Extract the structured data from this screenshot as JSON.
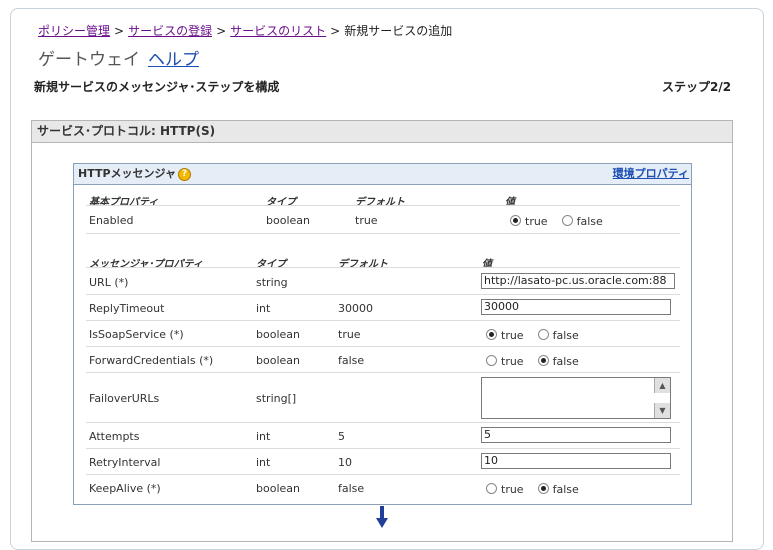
{
  "breadcrumb": {
    "items": [
      "ポリシー管理",
      "サービスの登録",
      "サービスのリスト"
    ],
    "current": "新規サービスの追加",
    "separator": ">"
  },
  "header": {
    "gateway": "ゲートウェイ",
    "help": "ヘルプ"
  },
  "page": {
    "title": "新規サービスのメッセンジャ･ステップを構成",
    "step": "ステップ2/2"
  },
  "section": {
    "title": "サービス･プロトコル: HTTP(S)"
  },
  "panel": {
    "title": "HTTPメッセンジャ",
    "help_icon": "?",
    "env_link": "環境プロパティ",
    "basic": {
      "headers": [
        "基本プロパティ",
        "タイプ",
        "デフォルト",
        "値"
      ],
      "rows": [
        {
          "name": "Enabled",
          "type": "boolean",
          "default": "true",
          "value": "true"
        }
      ]
    },
    "messenger": {
      "headers": [
        "メッセンジャ･プロパティ",
        "タイプ",
        "デフォルト",
        "値"
      ],
      "rows": [
        {
          "name": "URL (*)",
          "type": "string",
          "default": "",
          "value": "http://lasato-pc.us.oracle.com:88"
        },
        {
          "name": "ReplyTimeout",
          "type": "int",
          "default": "30000",
          "value": "30000"
        },
        {
          "name": "IsSoapService (*)",
          "type": "boolean",
          "default": "true",
          "value": "true"
        },
        {
          "name": "ForwardCredentials (*)",
          "type": "boolean",
          "default": "false",
          "value": "false"
        },
        {
          "name": "FailoverURLs",
          "type": "string[]",
          "default": "",
          "value": ""
        },
        {
          "name": "Attempts",
          "type": "int",
          "default": "5",
          "value": "5"
        },
        {
          "name": "RetryInterval",
          "type": "int",
          "default": "10",
          "value": "10"
        },
        {
          "name": "KeepAlive (*)",
          "type": "boolean",
          "default": "false",
          "value": "false"
        }
      ]
    },
    "radio_labels": {
      "true": "true",
      "false": "false"
    }
  },
  "colors": {
    "link": "#1e4fb5",
    "visited_link": "#6a0f8a",
    "panel_header_bg": "#e5edf6",
    "arrow": "#1f3f9a"
  },
  "icons": {
    "help": "help-icon",
    "down_arrow": "down-arrow-icon",
    "scroll_up": "scroll-up-icon",
    "scroll_down": "scroll-down-icon"
  }
}
